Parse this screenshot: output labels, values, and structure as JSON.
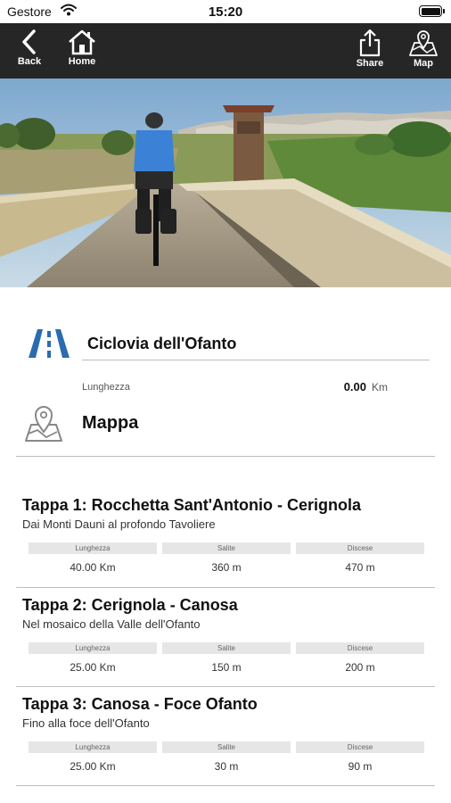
{
  "status_bar": {
    "carrier": "Gestore",
    "time": "15:20"
  },
  "navbar": {
    "back_label": "Back",
    "home_label": "Home",
    "share_label": "Share",
    "map_label": "Map"
  },
  "route": {
    "title": "Ciclovia dell'Ofanto",
    "length_label": "Lunghezza",
    "length_value": "0.00",
    "length_unit": "Km"
  },
  "map": {
    "title": "Mappa"
  },
  "stages": [
    {
      "title": "Tappa 1: Rocchetta Sant'Antonio - Cerignola",
      "subtitle": "Dai Monti Dauni al profondo Tavoliere",
      "length_header": "Lunghezza",
      "length": "40.00 Km",
      "ascent_header": "Salite",
      "ascent": "360 m",
      "descent_header": "Discese",
      "descent": "470 m"
    },
    {
      "title": "Tappa 2: Cerignola - Canosa",
      "subtitle": "Nel mosaico della Valle dell'Ofanto",
      "length_header": "Lunghezza",
      "length": "25.00 Km",
      "ascent_header": "Salite",
      "ascent": "150 m",
      "descent_header": "Discese",
      "descent": "200 m"
    },
    {
      "title": "Tappa 3: Canosa - Foce Ofanto",
      "subtitle": "Fino alla foce dell'Ofanto",
      "length_header": "Lunghezza",
      "length": "25.00 Km",
      "ascent_header": "Salite",
      "ascent": "30 m",
      "descent_header": "Discese",
      "descent": "90 m"
    }
  ],
  "colors": {
    "navbar": "#262626",
    "route_icon": "#2b6cb0",
    "stat_header": "#e6e6e6"
  },
  "icons": [
    "back-icon",
    "home-icon",
    "share-icon",
    "map-icon",
    "road-icon",
    "map-pin-icon",
    "wifi-icon",
    "battery-icon"
  ]
}
